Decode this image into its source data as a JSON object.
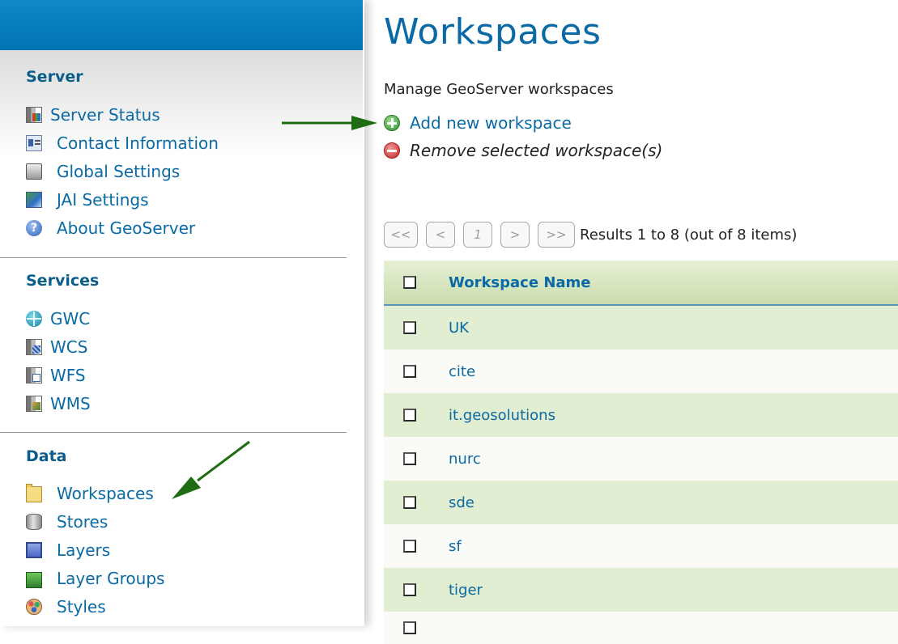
{
  "sidebar": {
    "sections": [
      {
        "title": "Server",
        "items": [
          {
            "label": "Server Status",
            "icon": "server-status-icon"
          },
          {
            "label": "Contact Information",
            "icon": "contact-card-icon"
          },
          {
            "label": "Global Settings",
            "icon": "global-settings-icon"
          },
          {
            "label": "JAI Settings",
            "icon": "jai-settings-icon"
          },
          {
            "label": "About GeoServer",
            "icon": "about-icon"
          }
        ]
      },
      {
        "title": "Services",
        "items": [
          {
            "label": "GWC",
            "icon": "gwc-globe-icon"
          },
          {
            "label": "WCS",
            "icon": "wcs-icon"
          },
          {
            "label": "WFS",
            "icon": "wfs-icon"
          },
          {
            "label": "WMS",
            "icon": "wms-icon"
          }
        ]
      },
      {
        "title": "Data",
        "items": [
          {
            "label": "Workspaces",
            "icon": "folder-icon"
          },
          {
            "label": "Stores",
            "icon": "stores-icon"
          },
          {
            "label": "Layers",
            "icon": "layers-icon"
          },
          {
            "label": "Layer Groups",
            "icon": "layer-groups-icon"
          },
          {
            "label": "Styles",
            "icon": "styles-icon"
          }
        ]
      }
    ]
  },
  "main": {
    "title": "Workspaces",
    "subtitle": "Manage GeoServer workspaces",
    "actions": {
      "add": "Add new workspace",
      "remove": "Remove selected workspace(s)"
    },
    "pager": {
      "first": "<<",
      "prev": "<",
      "page": "1",
      "next": ">",
      "last": ">>",
      "status": "Results 1 to 8 (out of 8 items)"
    },
    "table": {
      "header": "Workspace Name",
      "rows": [
        "UK",
        "cite",
        "it.geosolutions",
        "nurc",
        "sde",
        "sf",
        "tiger"
      ]
    }
  },
  "colors": {
    "topbar": "#0074b4",
    "link": "#0a6aa4",
    "section_title": "#0b5d8c",
    "row_alt": "#e2eed2",
    "arrow": "#1f6b12"
  }
}
